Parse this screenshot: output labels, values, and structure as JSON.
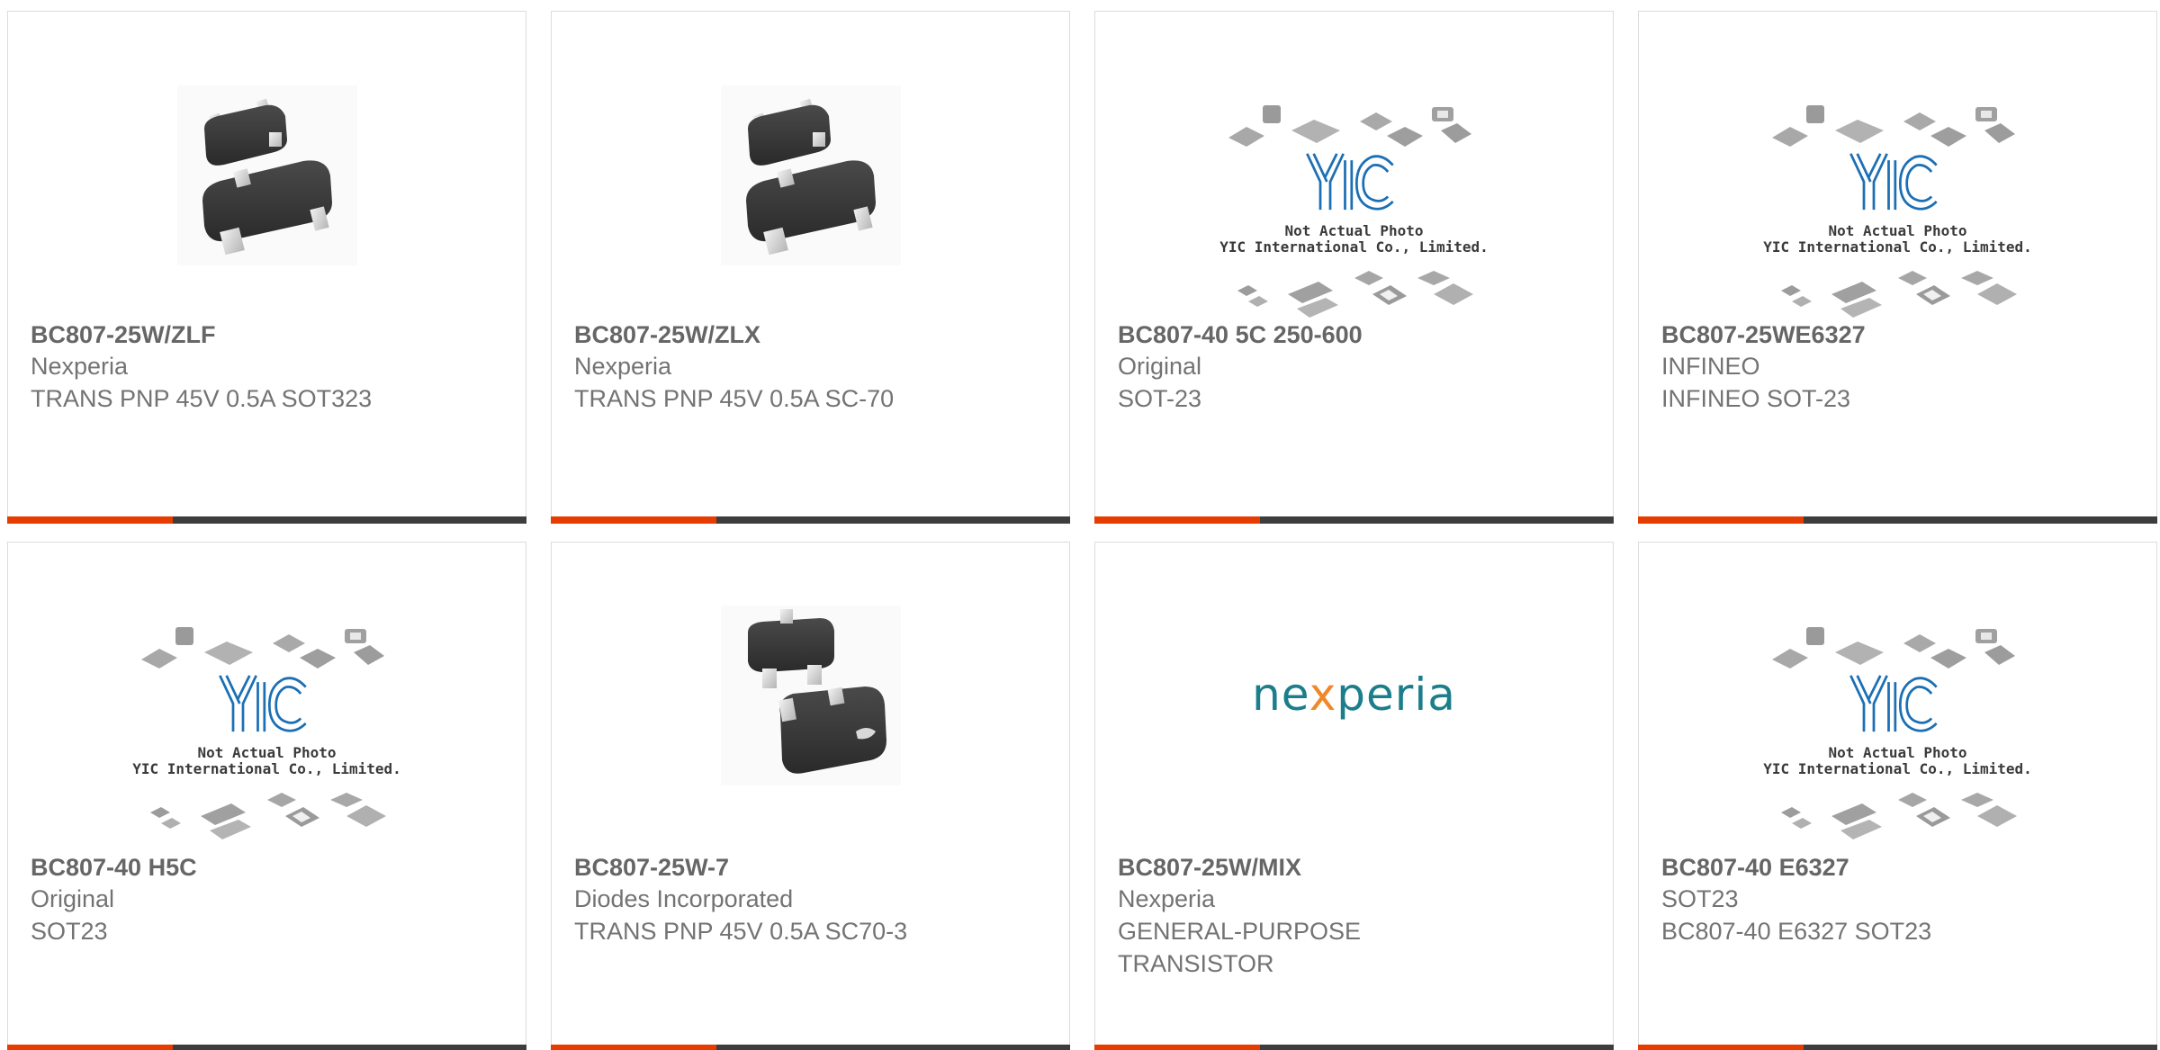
{
  "colors": {
    "accent": "#e63c00",
    "bar": "#3d3d3d",
    "text": "#666666",
    "yic_blue": "#1b6fb5",
    "nexperia_teal": "#1b7e8a",
    "nexperia_orange": "#f0882a"
  },
  "placeholder": {
    "line1": "Not Actual Photo",
    "line2": "YIC International Co., Limited.",
    "logo": "YIC"
  },
  "nexperia_logo": {
    "pre": "ne",
    "x": "x",
    "post": "peria"
  },
  "products": [
    {
      "part": "BC807-25W/ZLF",
      "maker": "Nexperia",
      "desc": "TRANS PNP 45V 0.5A SOT323",
      "image": "sot323-chip-icon"
    },
    {
      "part": "BC807-25W/ZLX",
      "maker": "Nexperia",
      "desc": "TRANS PNP 45V 0.5A SC-70",
      "image": "sot323-chip-icon"
    },
    {
      "part": "BC807-40 5C 250-600",
      "maker": "Original",
      "desc": "SOT-23",
      "image": "yic-placeholder"
    },
    {
      "part": "BC807-25WE6327",
      "maker": "INFINEO",
      "desc": "INFINEO SOT-23",
      "image": "yic-placeholder"
    },
    {
      "part": "BC807-40 H5C",
      "maker": "Original",
      "desc": "SOT23",
      "image": "yic-placeholder"
    },
    {
      "part": "BC807-25W-7",
      "maker": "Diodes Incorporated",
      "desc": "TRANS PNP 45V 0.5A SC70-3",
      "image": "sc70-chip-icon"
    },
    {
      "part": "BC807-25W/MIX",
      "maker": "Nexperia",
      "desc": "GENERAL-PURPOSE TRANSISTOR",
      "image": "nexperia-logo"
    },
    {
      "part": "BC807-40 E6327",
      "maker": "SOT23",
      "desc": "BC807-40 E6327 SOT23",
      "image": "yic-placeholder"
    }
  ]
}
